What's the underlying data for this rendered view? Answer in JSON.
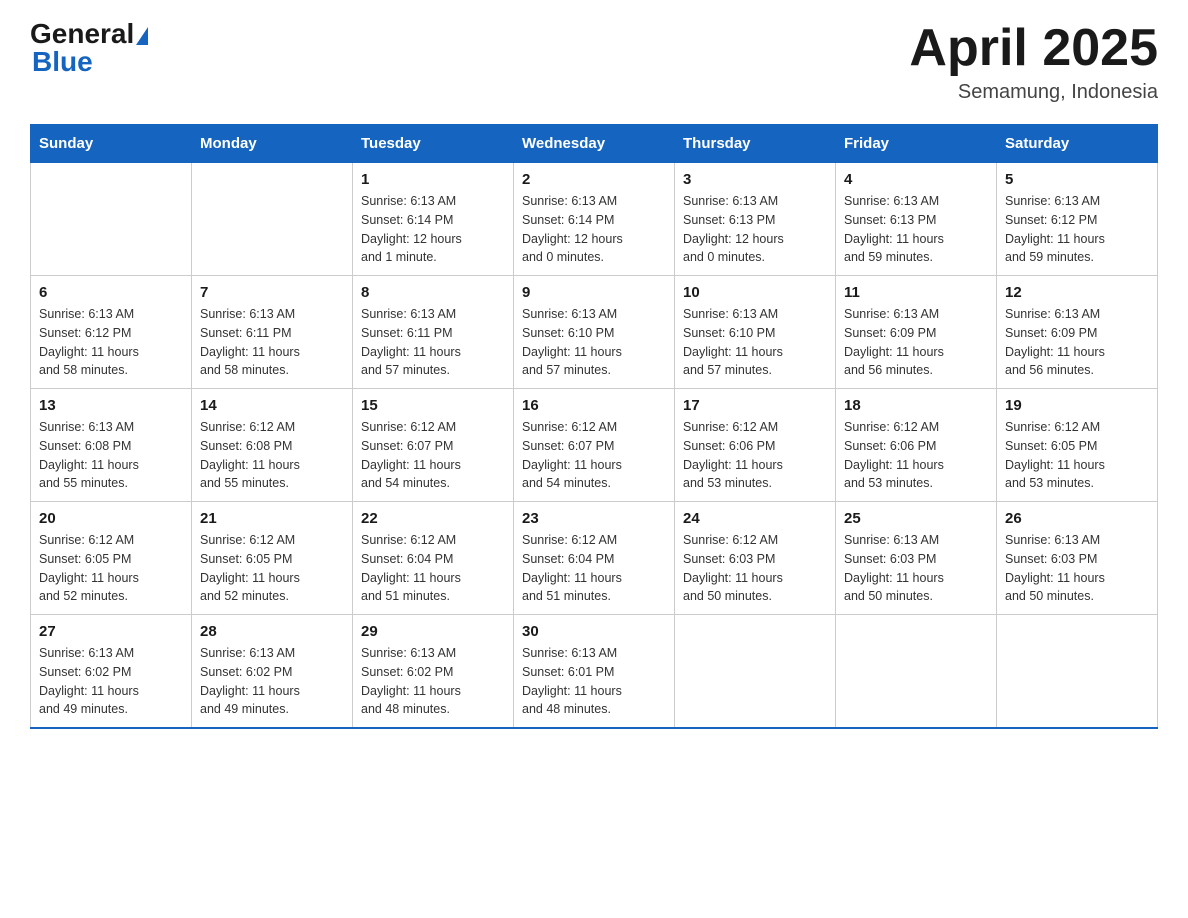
{
  "header": {
    "logo_general": "General",
    "logo_blue": "Blue",
    "month_title": "April 2025",
    "location": "Semamung, Indonesia"
  },
  "weekdays": [
    "Sunday",
    "Monday",
    "Tuesday",
    "Wednesday",
    "Thursday",
    "Friday",
    "Saturday"
  ],
  "weeks": [
    [
      {
        "day": "",
        "info": ""
      },
      {
        "day": "",
        "info": ""
      },
      {
        "day": "1",
        "info": "Sunrise: 6:13 AM\nSunset: 6:14 PM\nDaylight: 12 hours\nand 1 minute."
      },
      {
        "day": "2",
        "info": "Sunrise: 6:13 AM\nSunset: 6:14 PM\nDaylight: 12 hours\nand 0 minutes."
      },
      {
        "day": "3",
        "info": "Sunrise: 6:13 AM\nSunset: 6:13 PM\nDaylight: 12 hours\nand 0 minutes."
      },
      {
        "day": "4",
        "info": "Sunrise: 6:13 AM\nSunset: 6:13 PM\nDaylight: 11 hours\nand 59 minutes."
      },
      {
        "day": "5",
        "info": "Sunrise: 6:13 AM\nSunset: 6:12 PM\nDaylight: 11 hours\nand 59 minutes."
      }
    ],
    [
      {
        "day": "6",
        "info": "Sunrise: 6:13 AM\nSunset: 6:12 PM\nDaylight: 11 hours\nand 58 minutes."
      },
      {
        "day": "7",
        "info": "Sunrise: 6:13 AM\nSunset: 6:11 PM\nDaylight: 11 hours\nand 58 minutes."
      },
      {
        "day": "8",
        "info": "Sunrise: 6:13 AM\nSunset: 6:11 PM\nDaylight: 11 hours\nand 57 minutes."
      },
      {
        "day": "9",
        "info": "Sunrise: 6:13 AM\nSunset: 6:10 PM\nDaylight: 11 hours\nand 57 minutes."
      },
      {
        "day": "10",
        "info": "Sunrise: 6:13 AM\nSunset: 6:10 PM\nDaylight: 11 hours\nand 57 minutes."
      },
      {
        "day": "11",
        "info": "Sunrise: 6:13 AM\nSunset: 6:09 PM\nDaylight: 11 hours\nand 56 minutes."
      },
      {
        "day": "12",
        "info": "Sunrise: 6:13 AM\nSunset: 6:09 PM\nDaylight: 11 hours\nand 56 minutes."
      }
    ],
    [
      {
        "day": "13",
        "info": "Sunrise: 6:13 AM\nSunset: 6:08 PM\nDaylight: 11 hours\nand 55 minutes."
      },
      {
        "day": "14",
        "info": "Sunrise: 6:12 AM\nSunset: 6:08 PM\nDaylight: 11 hours\nand 55 minutes."
      },
      {
        "day": "15",
        "info": "Sunrise: 6:12 AM\nSunset: 6:07 PM\nDaylight: 11 hours\nand 54 minutes."
      },
      {
        "day": "16",
        "info": "Sunrise: 6:12 AM\nSunset: 6:07 PM\nDaylight: 11 hours\nand 54 minutes."
      },
      {
        "day": "17",
        "info": "Sunrise: 6:12 AM\nSunset: 6:06 PM\nDaylight: 11 hours\nand 53 minutes."
      },
      {
        "day": "18",
        "info": "Sunrise: 6:12 AM\nSunset: 6:06 PM\nDaylight: 11 hours\nand 53 minutes."
      },
      {
        "day": "19",
        "info": "Sunrise: 6:12 AM\nSunset: 6:05 PM\nDaylight: 11 hours\nand 53 minutes."
      }
    ],
    [
      {
        "day": "20",
        "info": "Sunrise: 6:12 AM\nSunset: 6:05 PM\nDaylight: 11 hours\nand 52 minutes."
      },
      {
        "day": "21",
        "info": "Sunrise: 6:12 AM\nSunset: 6:05 PM\nDaylight: 11 hours\nand 52 minutes."
      },
      {
        "day": "22",
        "info": "Sunrise: 6:12 AM\nSunset: 6:04 PM\nDaylight: 11 hours\nand 51 minutes."
      },
      {
        "day": "23",
        "info": "Sunrise: 6:12 AM\nSunset: 6:04 PM\nDaylight: 11 hours\nand 51 minutes."
      },
      {
        "day": "24",
        "info": "Sunrise: 6:12 AM\nSunset: 6:03 PM\nDaylight: 11 hours\nand 50 minutes."
      },
      {
        "day": "25",
        "info": "Sunrise: 6:13 AM\nSunset: 6:03 PM\nDaylight: 11 hours\nand 50 minutes."
      },
      {
        "day": "26",
        "info": "Sunrise: 6:13 AM\nSunset: 6:03 PM\nDaylight: 11 hours\nand 50 minutes."
      }
    ],
    [
      {
        "day": "27",
        "info": "Sunrise: 6:13 AM\nSunset: 6:02 PM\nDaylight: 11 hours\nand 49 minutes."
      },
      {
        "day": "28",
        "info": "Sunrise: 6:13 AM\nSunset: 6:02 PM\nDaylight: 11 hours\nand 49 minutes."
      },
      {
        "day": "29",
        "info": "Sunrise: 6:13 AM\nSunset: 6:02 PM\nDaylight: 11 hours\nand 48 minutes."
      },
      {
        "day": "30",
        "info": "Sunrise: 6:13 AM\nSunset: 6:01 PM\nDaylight: 11 hours\nand 48 minutes."
      },
      {
        "day": "",
        "info": ""
      },
      {
        "day": "",
        "info": ""
      },
      {
        "day": "",
        "info": ""
      }
    ]
  ]
}
